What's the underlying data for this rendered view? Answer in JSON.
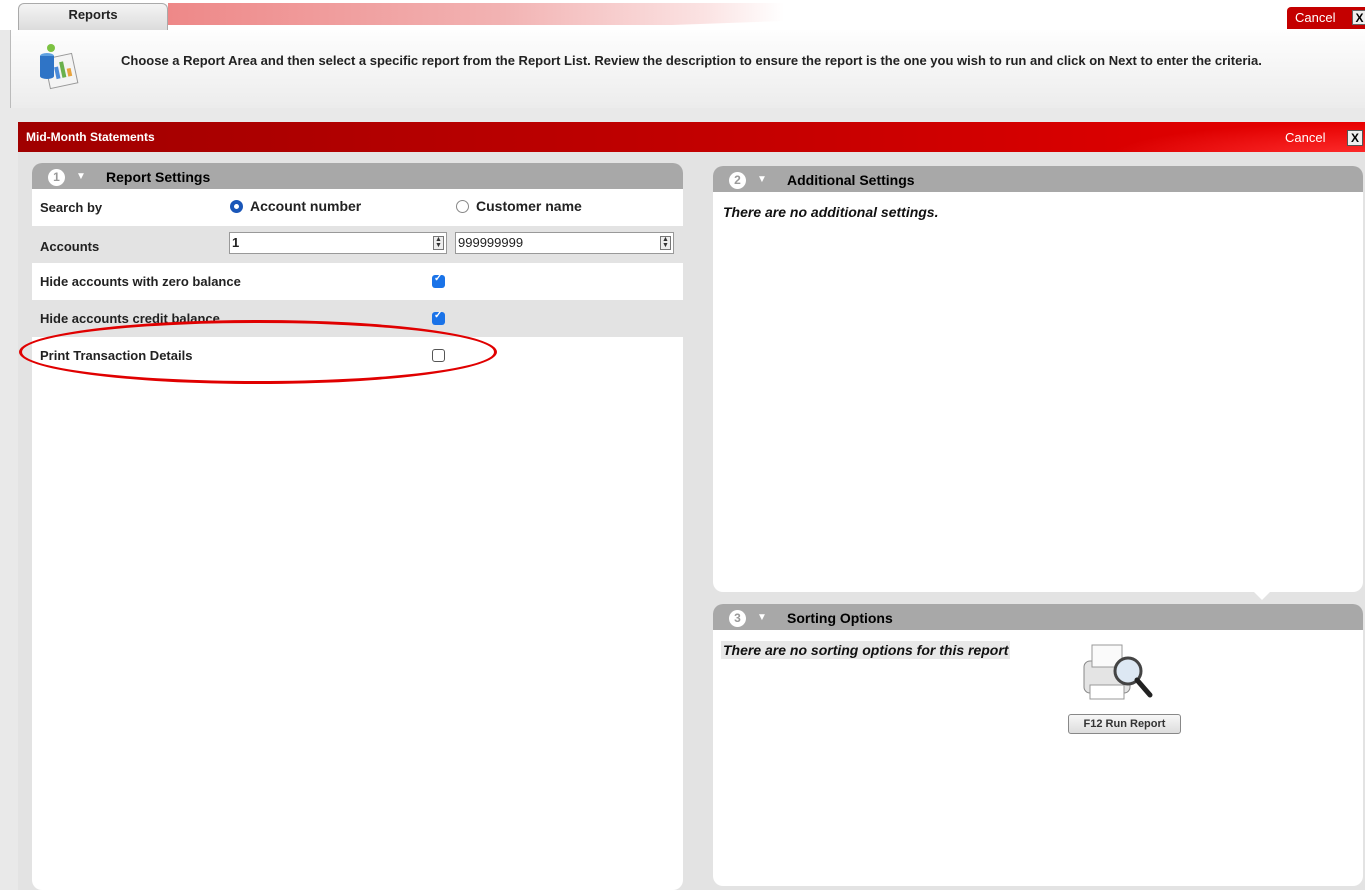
{
  "tabstrip": {
    "tab_label": "Reports",
    "cancel_label": "Cancel",
    "close_glyph": "X"
  },
  "header": {
    "instructions": "Choose a Report Area and then select a specific report from the Report List. Review the description to ensure the report is the one you wish to run and click on Next to enter the criteria.",
    "icon": "report-chart-icon"
  },
  "panel": {
    "title": "Mid-Month Statements",
    "cancel_label": "Cancel",
    "close_glyph": "X"
  },
  "report_settings": {
    "number": "1",
    "title": "Report Settings",
    "search_by": {
      "label": "Search by",
      "options": [
        "Account number",
        "Customer name"
      ],
      "selected": "Account number"
    },
    "accounts": {
      "label": "Accounts",
      "from_value": "1",
      "to_value": "999999999"
    },
    "hide_zero_balance": {
      "label": "Hide accounts with zero balance",
      "checked": true
    },
    "hide_credit_balance": {
      "label": "Hide accounts credit balance",
      "checked": true
    },
    "print_transaction_details": {
      "label": "Print Transaction Details",
      "checked": false
    }
  },
  "additional_settings": {
    "number": "2",
    "title": "Additional Settings",
    "message": "There are no additional settings."
  },
  "sorting_options": {
    "number": "3",
    "title": "Sorting Options",
    "message": "There are no sorting options for this report"
  },
  "run_report": {
    "label": "F12  Run Report",
    "icon": "printer-magnifier-icon"
  },
  "colors": {
    "accent_red": "#c80000",
    "checkbox_blue": "#1a73e8",
    "highlight": "#e00000"
  }
}
